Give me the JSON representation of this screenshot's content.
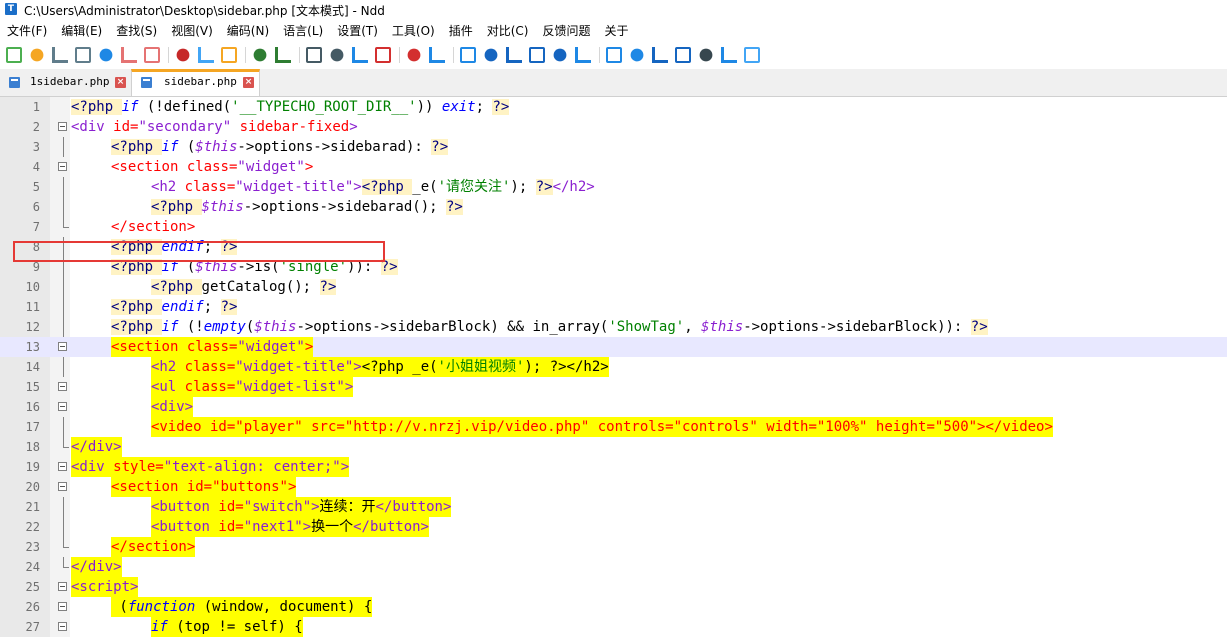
{
  "window": {
    "title": "C:\\Users\\Administrator\\Desktop\\sidebar.php [文本模式] - Ndd",
    "app_icon": "ndd-app-icon"
  },
  "menu": [
    "文件(F)",
    "编辑(E)",
    "查找(S)",
    "视图(V)",
    "编码(N)",
    "语言(L)",
    "设置(T)",
    "工具(O)",
    "插件",
    "对比(C)",
    "反馈问题",
    "关于"
  ],
  "toolbar": {
    "icons": [
      "new-file-icon",
      "open-file-icon",
      "save-icon",
      "save-all-icon",
      "reload-icon",
      "close-icon",
      "close-all-icon",
      "cut-icon",
      "copy-icon",
      "paste-icon",
      "undo-icon",
      "redo-icon",
      "find-icon",
      "replace-icon",
      "goto-icon",
      "mark-icon",
      "clear-mark-icon",
      "zoom-in-icon",
      "zoom-out-icon",
      "wrap-icon",
      "show-symbols-icon",
      "indent-guide-icon",
      "macro-icon",
      "prev-icon",
      "next-icon",
      "go-icon",
      "compare-icon",
      "split-icon",
      "monitor-icon",
      "tree-icon",
      "bracket-icon"
    ]
  },
  "tabs": [
    {
      "label": "1sidebar.php",
      "active": false
    },
    {
      "label": "sidebar.php",
      "active": true
    }
  ],
  "editor": {
    "current_line": 13,
    "lines": [
      {
        "n": "1",
        "indent": 0,
        "hl": false,
        "fold": "",
        "tokens": [
          [
            "ph",
            "<?php "
          ],
          [
            "kw",
            "if"
          ],
          [
            "plain",
            " (!defined("
          ],
          [
            "str",
            "'__TYPECHO_ROOT_DIR__'"
          ],
          [
            "plain",
            ")) "
          ],
          [
            "kw",
            "exit"
          ],
          [
            "plain",
            "; "
          ],
          [
            "ph",
            "?>"
          ]
        ]
      },
      {
        "n": "2",
        "indent": 0,
        "hl": false,
        "fold": "open",
        "tokens": [
          [
            "tag",
            "<div "
          ],
          [
            "attr",
            "id="
          ],
          [
            "tag",
            "\"secondary\" "
          ],
          [
            "attr",
            "sidebar-fixed"
          ],
          [
            "tag",
            ">"
          ]
        ]
      },
      {
        "n": "3",
        "indent": 4,
        "hl": false,
        "fold": "line",
        "tokens": [
          [
            "ph",
            "<?php "
          ],
          [
            "kw",
            "if"
          ],
          [
            "plain",
            " ("
          ],
          [
            "var",
            "$this"
          ],
          [
            "plain",
            "->options->sidebarad): "
          ],
          [
            "ph",
            "?>"
          ]
        ]
      },
      {
        "n": "4",
        "indent": 4,
        "hl": false,
        "fold": "open",
        "tokens": [
          [
            "tagr",
            "<section "
          ],
          [
            "attr",
            "class="
          ],
          [
            "tag",
            "\"widget\""
          ],
          [
            "tagr",
            ">"
          ]
        ]
      },
      {
        "n": "5",
        "indent": 8,
        "hl": false,
        "fold": "line",
        "tokens": [
          [
            "tag",
            "<h2 "
          ],
          [
            "attr",
            "class="
          ],
          [
            "tag",
            "\"widget-title\">"
          ],
          [
            "ph",
            "<?php "
          ],
          [
            "plain",
            "_e("
          ],
          [
            "str",
            "'请您关注'"
          ],
          [
            "plain",
            "); "
          ],
          [
            "ph",
            "?>"
          ],
          [
            "tag",
            "</h2>"
          ]
        ]
      },
      {
        "n": "6",
        "indent": 8,
        "hl": false,
        "fold": "line",
        "tokens": [
          [
            "ph",
            "<?php "
          ],
          [
            "var",
            "$this"
          ],
          [
            "plain",
            "->options->sidebarad(); "
          ],
          [
            "ph",
            "?>"
          ]
        ]
      },
      {
        "n": "7",
        "indent": 4,
        "hl": false,
        "fold": "end",
        "tokens": [
          [
            "tagr",
            "</section>"
          ]
        ]
      },
      {
        "n": "8",
        "indent": 4,
        "hl": false,
        "fold": "line",
        "tokens": [
          [
            "ph",
            "<?php "
          ],
          [
            "kw",
            "endif"
          ],
          [
            "plain",
            "; "
          ],
          [
            "ph",
            "?>"
          ]
        ]
      },
      {
        "n": "9",
        "indent": 4,
        "hl": false,
        "fold": "line",
        "tokens": [
          [
            "ph",
            "<?php "
          ],
          [
            "kw",
            "if"
          ],
          [
            "plain",
            " ("
          ],
          [
            "var",
            "$this"
          ],
          [
            "plain",
            "->is("
          ],
          [
            "str",
            "'single'"
          ],
          [
            "plain",
            ")): "
          ],
          [
            "ph",
            "?>"
          ]
        ]
      },
      {
        "n": "10",
        "indent": 8,
        "hl": false,
        "fold": "line",
        "tokens": [
          [
            "ph",
            "<?php "
          ],
          [
            "plain",
            "getCatalog(); "
          ],
          [
            "ph",
            "?>"
          ]
        ]
      },
      {
        "n": "11",
        "indent": 4,
        "hl": false,
        "fold": "line",
        "tokens": [
          [
            "ph",
            "<?php "
          ],
          [
            "kw",
            "endif"
          ],
          [
            "plain",
            "; "
          ],
          [
            "ph",
            "?>"
          ]
        ]
      },
      {
        "n": "12",
        "indent": 4,
        "hl": false,
        "fold": "line",
        "tokens": [
          [
            "ph",
            "<?php "
          ],
          [
            "kw",
            "if"
          ],
          [
            "plain",
            " (!"
          ],
          [
            "kw",
            "empty"
          ],
          [
            "plain",
            "("
          ],
          [
            "var",
            "$this"
          ],
          [
            "plain",
            "->options->sidebarBlock) && in_array("
          ],
          [
            "str",
            "'ShowTag'"
          ],
          [
            "plain",
            ", "
          ],
          [
            "var",
            "$this"
          ],
          [
            "plain",
            "->options->sidebarBlock)): "
          ],
          [
            "ph",
            "?>"
          ]
        ]
      },
      {
        "n": "13",
        "indent": 4,
        "hl": true,
        "fold": "open",
        "tokens": [
          [
            "tagr",
            "<section "
          ],
          [
            "attr",
            "class="
          ],
          [
            "tag",
            "\"widget\""
          ],
          [
            "tagr",
            ">"
          ]
        ]
      },
      {
        "n": "14",
        "indent": 8,
        "hl": true,
        "fold": "line",
        "tokens": [
          [
            "tag",
            "<h2 "
          ],
          [
            "attr",
            "class="
          ],
          [
            "tag",
            "\"widget-title\">"
          ],
          [
            "plain",
            "<?php _e("
          ],
          [
            "str",
            "'小姐姐视频'"
          ],
          [
            "plain",
            "); ?></h2>"
          ]
        ]
      },
      {
        "n": "15",
        "indent": 8,
        "hl": true,
        "fold": "open",
        "tokens": [
          [
            "tag",
            "<ul "
          ],
          [
            "attr",
            "class="
          ],
          [
            "tag",
            "\"widget-list\">"
          ]
        ]
      },
      {
        "n": "16",
        "indent": 8,
        "hl": true,
        "fold": "open",
        "tokens": [
          [
            "tag",
            "<div>"
          ]
        ]
      },
      {
        "n": "17",
        "indent": 8,
        "hl": true,
        "fold": "line",
        "tokens": [
          [
            "tagr",
            "<video "
          ],
          [
            "attr",
            "id="
          ],
          [
            "tagr",
            "\"player\" "
          ],
          [
            "attr",
            "src="
          ],
          [
            "tagr",
            "\"http://v.nrzj.vip/video.php\" "
          ],
          [
            "attr",
            "controls="
          ],
          [
            "tagr",
            "\"controls\" "
          ],
          [
            "attr",
            "width="
          ],
          [
            "tagr",
            "\"100%\" "
          ],
          [
            "attr",
            "height="
          ],
          [
            "tagr",
            "\"500\"></video>"
          ]
        ]
      },
      {
        "n": "18",
        "indent": 0,
        "hl": true,
        "fold": "end",
        "tokens": [
          [
            "tag",
            "</div>"
          ]
        ]
      },
      {
        "n": "19",
        "indent": 0,
        "hl": true,
        "fold": "open",
        "tokens": [
          [
            "tag",
            "<div "
          ],
          [
            "attr",
            "style="
          ],
          [
            "tag",
            "\"text-align: center;\">"
          ]
        ]
      },
      {
        "n": "20",
        "indent": 4,
        "hl": true,
        "fold": "open",
        "tokens": [
          [
            "tagr",
            "<section "
          ],
          [
            "attr",
            "id="
          ],
          [
            "tagr",
            "\"buttons\">"
          ]
        ]
      },
      {
        "n": "21",
        "indent": 8,
        "hl": true,
        "fold": "line",
        "tokens": [
          [
            "tag",
            "<button "
          ],
          [
            "attr",
            "id="
          ],
          [
            "tag",
            "\"switch\">"
          ],
          [
            "plain",
            "连续：开"
          ],
          [
            "tag",
            "</button>"
          ]
        ]
      },
      {
        "n": "22",
        "indent": 8,
        "hl": true,
        "fold": "line",
        "tokens": [
          [
            "tag",
            "<button "
          ],
          [
            "attr",
            "id="
          ],
          [
            "tag",
            "\"next1\">"
          ],
          [
            "plain",
            "换一个"
          ],
          [
            "tag",
            "</button>"
          ]
        ]
      },
      {
        "n": "23",
        "indent": 4,
        "hl": true,
        "fold": "end",
        "tokens": [
          [
            "tagr",
            "</section>"
          ]
        ]
      },
      {
        "n": "24",
        "indent": 0,
        "hl": true,
        "fold": "end",
        "tokens": [
          [
            "tag",
            "</div>"
          ]
        ]
      },
      {
        "n": "25",
        "indent": 0,
        "hl": true,
        "fold": "open",
        "tokens": [
          [
            "tag",
            "<script>"
          ]
        ]
      },
      {
        "n": "26",
        "indent": 4,
        "hl": true,
        "fold": "open",
        "tokens": [
          [
            "plain",
            " ("
          ],
          [
            "kw",
            "function"
          ],
          [
            "plain",
            " (window, document) {"
          ]
        ]
      },
      {
        "n": "27",
        "indent": 8,
        "hl": true,
        "fold": "open",
        "tokens": [
          [
            "kw",
            "if"
          ],
          [
            "plain",
            " (top != self) {"
          ]
        ]
      }
    ]
  }
}
